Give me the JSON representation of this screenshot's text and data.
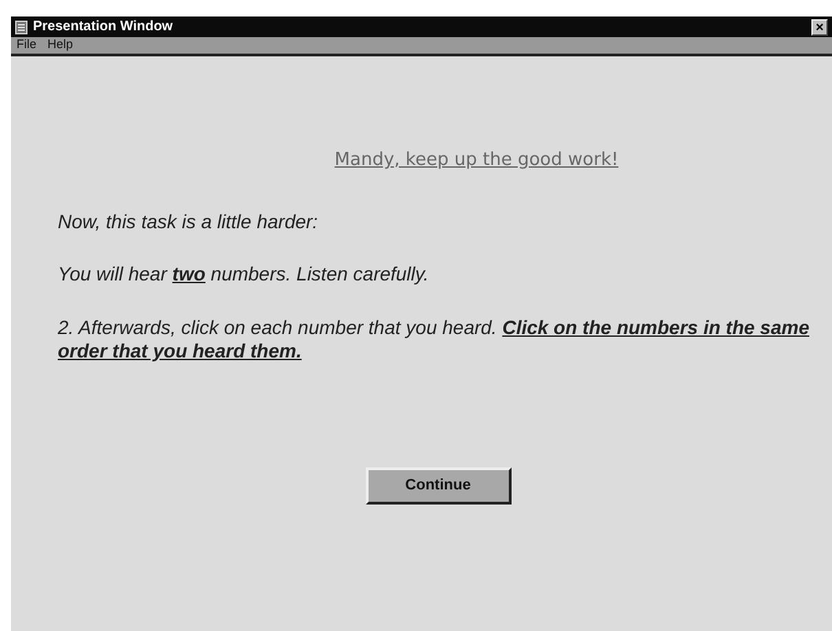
{
  "window": {
    "title": "Presentation Window",
    "close": "×"
  },
  "menu": [
    "File",
    "Help"
  ],
  "heading": "Mandy, keep up the good work!",
  "paragraphs": [
    "Now, this task is a little harder:",
    "You will hear **two** numbers.  Listen carefully.",
    "2. Afterwards, click on each number that you heard.  **Click on the numbers in the same order that you heard them.**"
  ],
  "buttons": [
    "Continue"
  ]
}
